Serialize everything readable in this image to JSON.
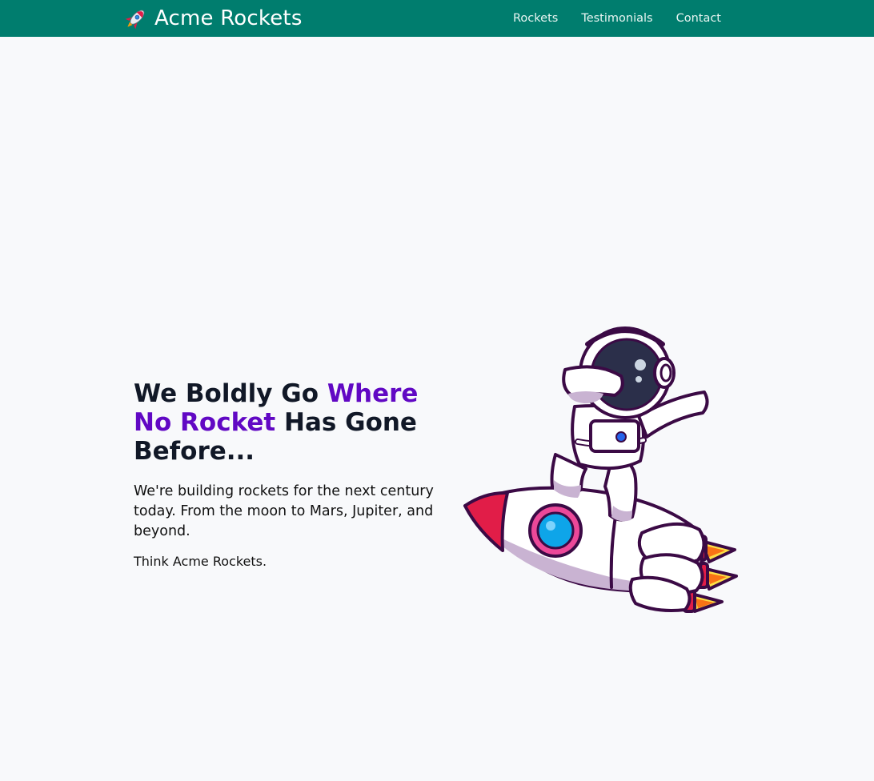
{
  "header": {
    "brand_emoji": "🚀",
    "brand_title": "Acme Rockets",
    "nav": [
      {
        "label": "Rockets"
      },
      {
        "label": "Testimonials"
      },
      {
        "label": "Contact"
      }
    ]
  },
  "hero": {
    "heading_part1": "We Boldly Go ",
    "heading_accent": "Where No Rocket",
    "heading_part2": " Has Gone Before...",
    "lead": "We're building rockets for the next century today. From the moon to Mars, Jupiter, and beyond.",
    "tagline": "Think Acme Rockets.",
    "illustration": "astronaut-riding-rocket"
  },
  "colors": {
    "header_bg": "#007d6e",
    "accent": "#6108c4",
    "page_bg": "#f8f9fb"
  }
}
